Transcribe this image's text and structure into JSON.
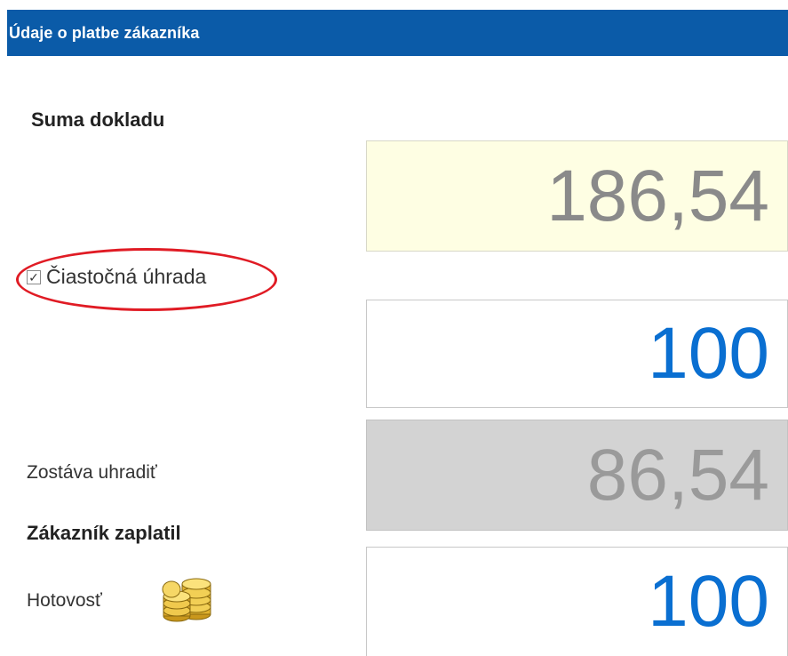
{
  "window": {
    "title": "Údaje o platbe zákazníka"
  },
  "labels": {
    "document_total": "Suma dokladu",
    "partial_payment": "Čiastočná úhrada",
    "remaining": "Zostáva uhradiť",
    "customer_paid": "Zákazník zaplatil",
    "cash": "Hotovosť"
  },
  "values": {
    "document_total": "186,54",
    "partial_payment": "100",
    "remaining": "86,54",
    "cash": "100"
  },
  "partial_payment_checked": true,
  "checkmark_glyph": "✓",
  "icons": {
    "cash": "coins-icon"
  },
  "colors": {
    "title_bar": "#0b5ba8",
    "total_bg": "#fefee3",
    "remaining_bg": "#d3d3d3",
    "value_blue": "#0a6fd1",
    "highlight": "#e01b24"
  }
}
